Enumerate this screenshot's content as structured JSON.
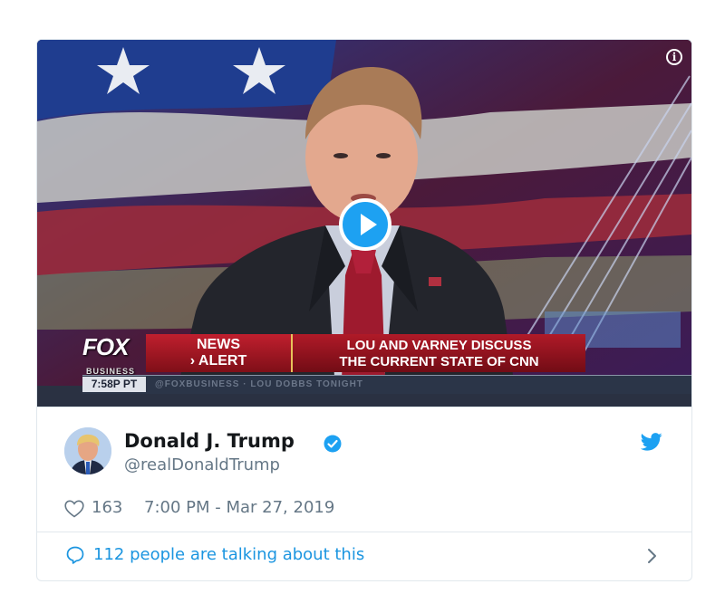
{
  "video": {
    "fox_logo": "FOX",
    "fox_sub": "BUSINESS",
    "news_alert_line1": "NEWS",
    "news_alert_line2": "› ALERT",
    "headline_line1": "LOU AND VARNEY DISCUSS",
    "headline_line2": "THE CURRENT STATE OF CNN",
    "ticker_time": "7:58P PT",
    "ticker_text": "@FOXBUSINESS   ·   LOU DOBBS TONIGHT",
    "info_icon": "i"
  },
  "tweet": {
    "author_name": "Donald J. Trump",
    "author_handle": "@realDonaldTrump",
    "like_count": "163",
    "timestamp": "7:00 PM - Mar 27, 2019",
    "talking": "112 people are talking about this"
  },
  "colors": {
    "accent": "#1da1f2",
    "link": "#1b95e0",
    "muted": "#657786"
  },
  "icons": [
    "info-icon",
    "play-icon",
    "verified-badge-icon",
    "twitter-bird-icon",
    "heart-icon",
    "speech-bubble-icon",
    "chevron-right-icon"
  ]
}
